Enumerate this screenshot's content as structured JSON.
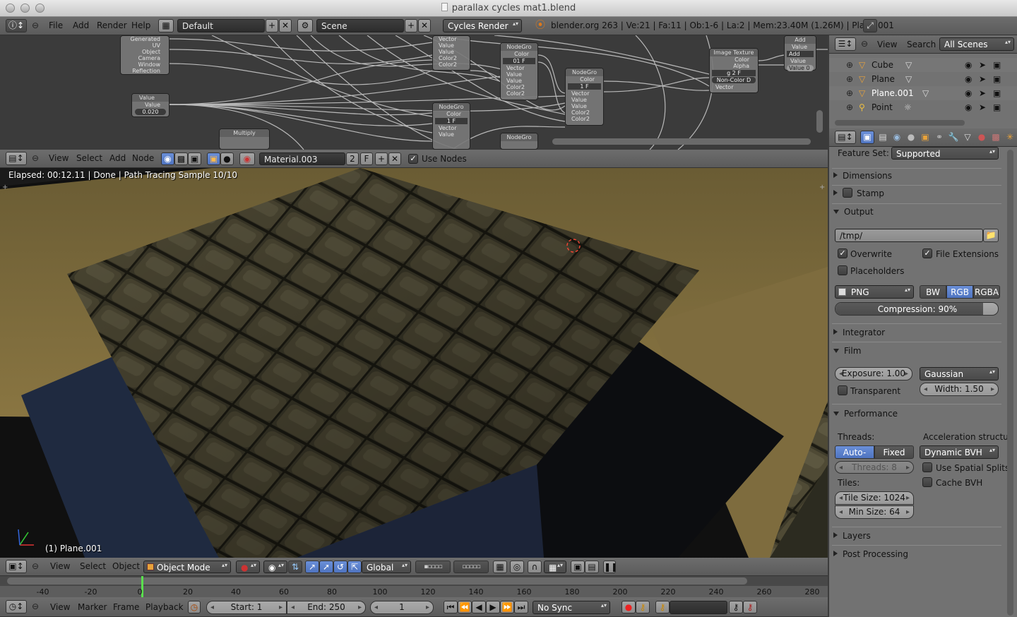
{
  "window": {
    "title": "parallax cycles mat1.blend"
  },
  "info_header": {
    "menus": [
      "File",
      "Add",
      "Render",
      "Help"
    ],
    "layout": "Default",
    "scene": "Scene",
    "engine": "Cycles Render",
    "stats": "blender.org 263 | Ve:21 | Fa:11 | Ob:1-6 | La:2 | Mem:23.40M (1.26M) | Plane.001"
  },
  "node_editor": {
    "menus": [
      "View",
      "Select",
      "Add",
      "Node"
    ],
    "material": "Material.003",
    "users": "2",
    "fake": "F",
    "use_nodes": "Use Nodes",
    "nodes": [
      {
        "title": "",
        "rows": [
          "Generated",
          "UV",
          "Object",
          "Camera",
          "Window",
          "Reflection"
        ]
      },
      {
        "title": "Value",
        "rows": [
          "Value",
          "0.020"
        ]
      },
      {
        "title": "",
        "rows": [
          "Vector",
          "Value",
          "Value",
          "Color2",
          "Color2"
        ]
      },
      {
        "title": "NodeGro",
        "rows": [
          "Color",
          "01 F",
          "Vector",
          "Value",
          "Value",
          "Color2",
          "Color2"
        ]
      },
      {
        "title": "NodeGro",
        "rows": [
          "Color",
          "1 F",
          "Vector",
          "Value",
          "Value",
          "Color2",
          "Color2"
        ]
      },
      {
        "title": "NodeGro",
        "rows": [
          "Color",
          "1 F",
          "Vector",
          "Value"
        ]
      },
      {
        "title": "Image Texture",
        "rows": [
          "Color",
          "Alpha",
          "g 2 F",
          "Non-Color D",
          "Vector"
        ]
      },
      {
        "title": "Add",
        "rows": [
          "Value",
          "Add",
          "Value",
          "Value 0"
        ]
      },
      {
        "title": "Multiply",
        "rows": []
      },
      {
        "title": "NodeGro",
        "rows": []
      }
    ]
  },
  "viewport": {
    "status": "Elapsed: 00:12.11 | Done | Path Tracing Sample 10/10",
    "object_label": "(1) Plane.001",
    "menus": [
      "View",
      "Select",
      "Object"
    ],
    "mode": "Object Mode",
    "orientation": "Global"
  },
  "timeline": {
    "ticks": [
      "-40",
      "-20",
      "0",
      "20",
      "40",
      "60",
      "80",
      "100",
      "120",
      "140",
      "160",
      "180",
      "200",
      "220",
      "240",
      "260",
      "280"
    ],
    "menus": [
      "View",
      "Marker",
      "Frame",
      "Playback"
    ],
    "start": "Start: 1",
    "end": "End: 250",
    "current": "1",
    "sync": "No Sync"
  },
  "outliner": {
    "menus": [
      "View",
      "Search"
    ],
    "filter": "All Scenes",
    "items": [
      {
        "name": "Cube",
        "icon": "mesh-icon"
      },
      {
        "name": "Plane",
        "icon": "mesh-icon"
      },
      {
        "name": "Plane.001",
        "icon": "mesh-icon",
        "selected": true
      },
      {
        "name": "Point",
        "icon": "lamp-icon"
      }
    ]
  },
  "properties": {
    "feature_set_label": "Feature Set:",
    "feature_set": "Supported",
    "dimensions": "Dimensions",
    "stamp": "Stamp",
    "output": "Output",
    "path": "/tmp/",
    "overwrite": "Overwrite",
    "file_extensions": "File Extensions",
    "placeholders": "Placeholders",
    "format": "PNG",
    "color_modes": [
      "BW",
      "RGB",
      "RGBA"
    ],
    "color_mode_active": "RGB",
    "compression": "Compression: 90%",
    "compression_value": 0.9,
    "integrator": "Integrator",
    "film": "Film",
    "exposure": "Exposure: 1.00",
    "filter": "Gaussian",
    "transparent": "Transparent",
    "width": "Width: 1.50",
    "performance": "Performance",
    "threads_label": "Threads:",
    "threads_modes": [
      "Auto-detec",
      "Fixed"
    ],
    "threads_count": "Threads: 8",
    "accel_label": "Acceleration structur",
    "accel": "Dynamic BVH",
    "spatial_splits": "Use Spatial Splits",
    "cache_bvh": "Cache BVH",
    "tiles_label": "Tiles:",
    "tile_size": "Tile Size: 1024",
    "min_size": "Min Size: 64",
    "layers": "Layers",
    "post_processing": "Post Processing"
  }
}
